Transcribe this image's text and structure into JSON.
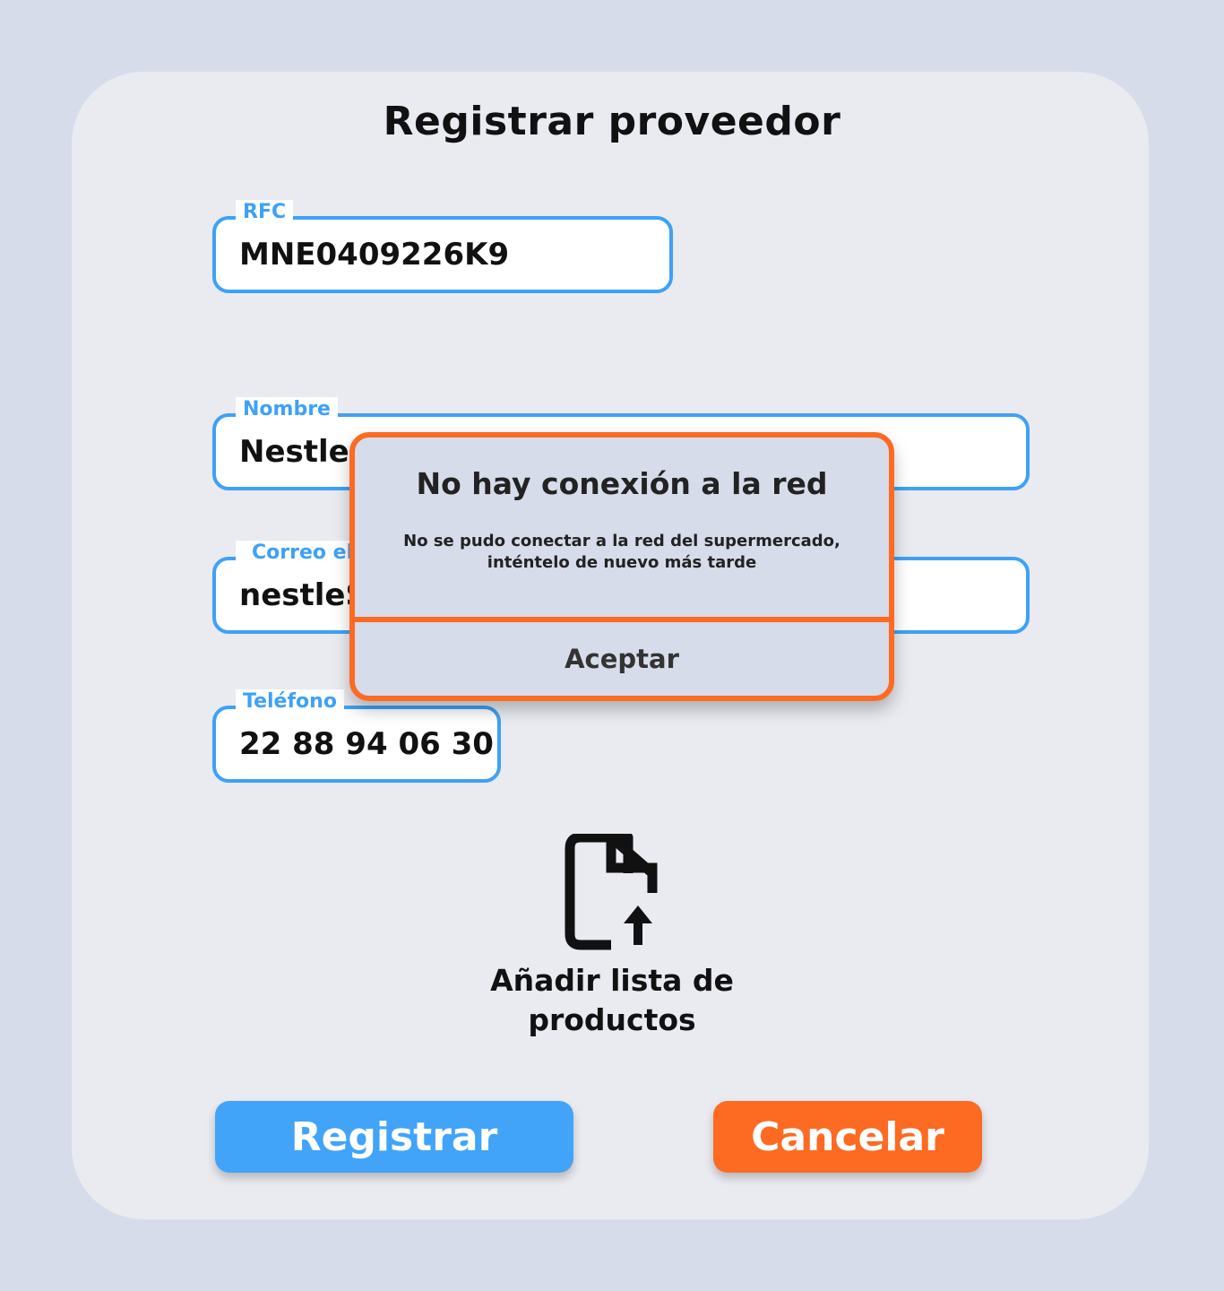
{
  "page": {
    "title": "Registrar proveedor"
  },
  "form": {
    "rfc": {
      "label": "RFC",
      "value": "MNE0409226K9"
    },
    "nombre": {
      "label": "Nombre",
      "value": "Nestle S"
    },
    "correo": {
      "label": "Correo el",
      "value": "nestleS"
    },
    "telefono": {
      "label": "Teléfono",
      "value": "22 88 94 06 30"
    }
  },
  "upload": {
    "icon": "file-upload-icon",
    "label": "Añadir lista de productos"
  },
  "buttons": {
    "register": "Registrar",
    "cancel": "Cancelar"
  },
  "dialog": {
    "title": "No hay conexión a la red",
    "message": "No se pudo conectar a la red del supermercado, inténtelo de nuevo más tarde",
    "accept": "Aceptar"
  },
  "colors": {
    "primary": "#41a4f8",
    "accent": "#fd6a22",
    "field_border": "#3ea1f7",
    "background": "#d7dcea",
    "card": "#e9ebf1"
  }
}
